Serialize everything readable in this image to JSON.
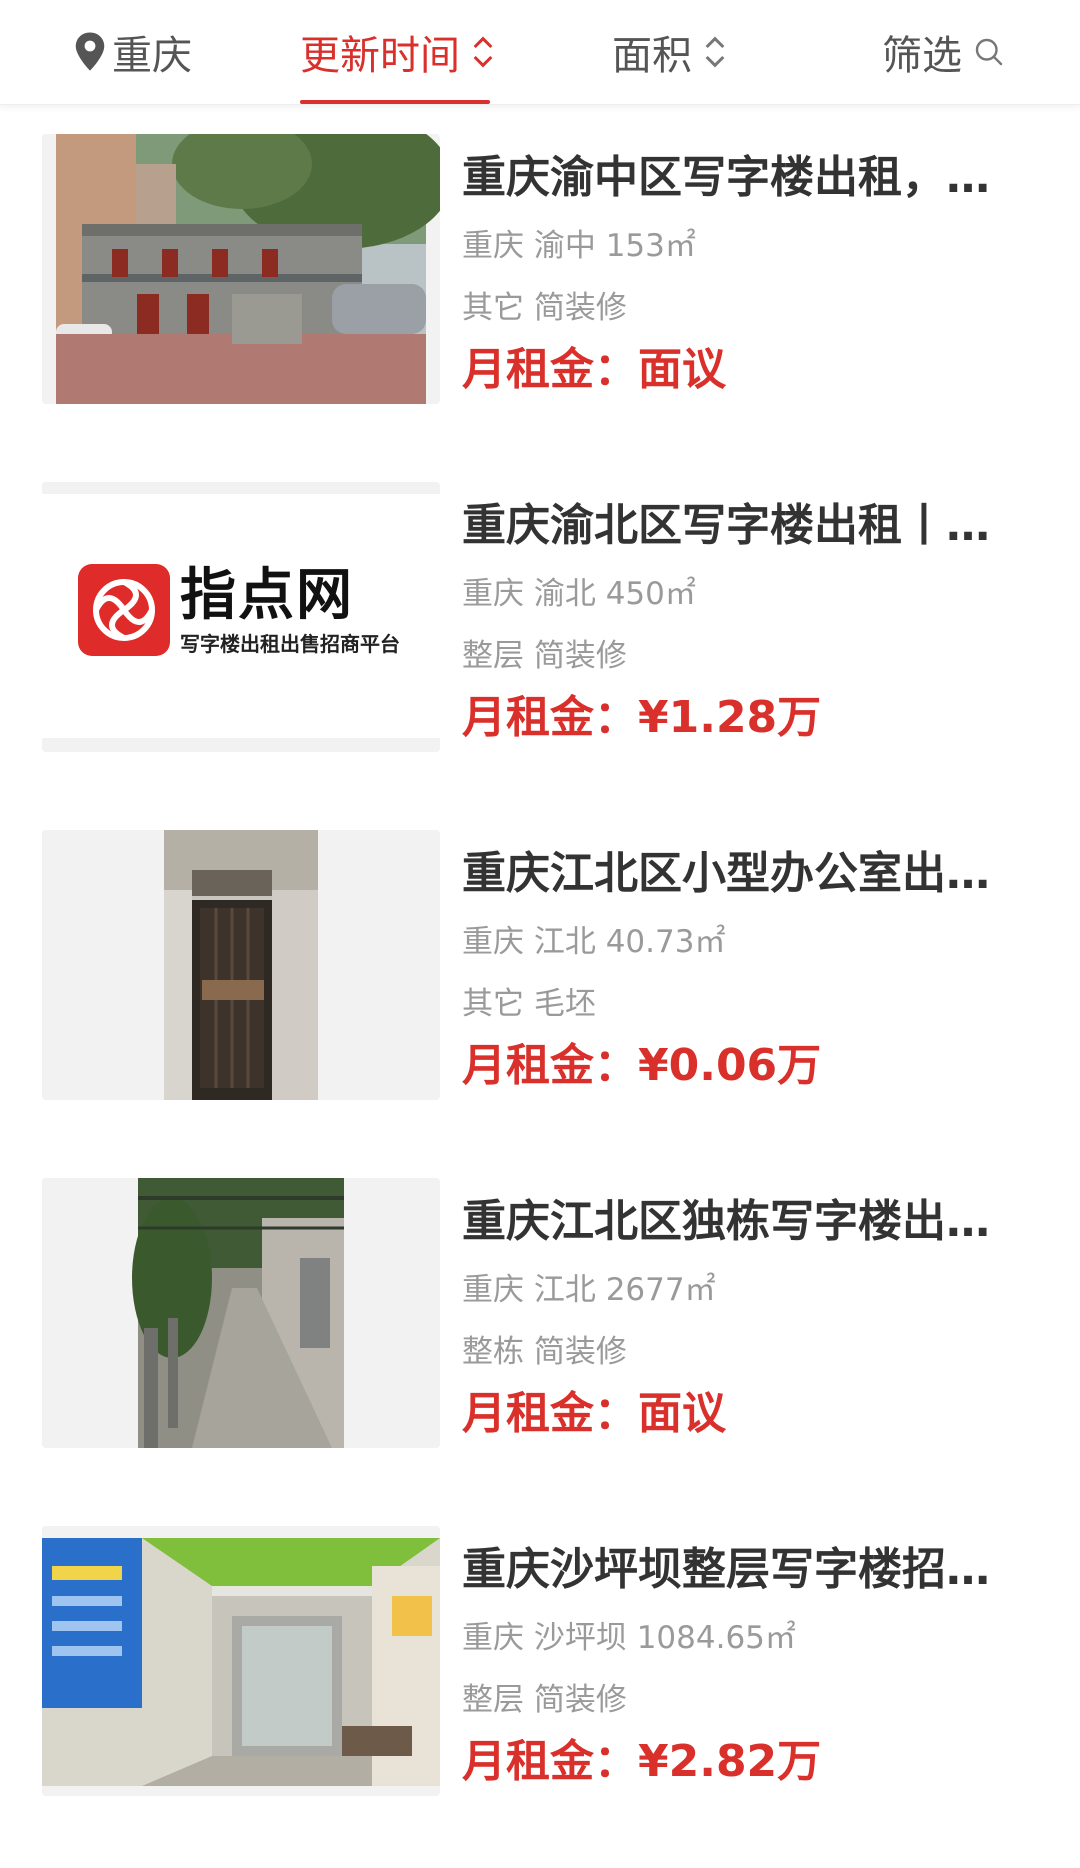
{
  "filter_bar": {
    "city": "重庆",
    "sort_time": "更新时间",
    "sort_area": "面积",
    "filter": "筛选"
  },
  "listings": [
    {
      "title": "重庆渝中区写字楼出租，…",
      "location": "重庆 渝中 153㎡",
      "tags": "其它 简装修",
      "price_label": "月租金：",
      "price": "面议"
    },
    {
      "title": "重庆渝北区写字楼出租丨…",
      "location": "重庆 渝北 450㎡",
      "tags": "整层 简装修",
      "price_label": "月租金：",
      "price": "¥1.28万",
      "logo_text": "指点网",
      "logo_tagline": "写字楼出租出售招商平台"
    },
    {
      "title": "重庆江北区小型办公室出…",
      "location": "重庆 江北 40.73㎡",
      "tags": "其它 毛坯",
      "price_label": "月租金：",
      "price": "¥0.06万"
    },
    {
      "title": "重庆江北区独栋写字楼出…",
      "location": "重庆 江北 2677㎡",
      "tags": "整栋 简装修",
      "price_label": "月租金：",
      "price": "面议"
    },
    {
      "title": "重庆沙坪坝整层写字楼招…",
      "location": "重庆 沙坪坝 1084.65㎡",
      "tags": "整层 简装修",
      "price_label": "月租金：",
      "price": "¥2.82万"
    }
  ],
  "colors": {
    "accent": "#d9302b",
    "title": "#333333",
    "meta": "#9a9a9a"
  }
}
